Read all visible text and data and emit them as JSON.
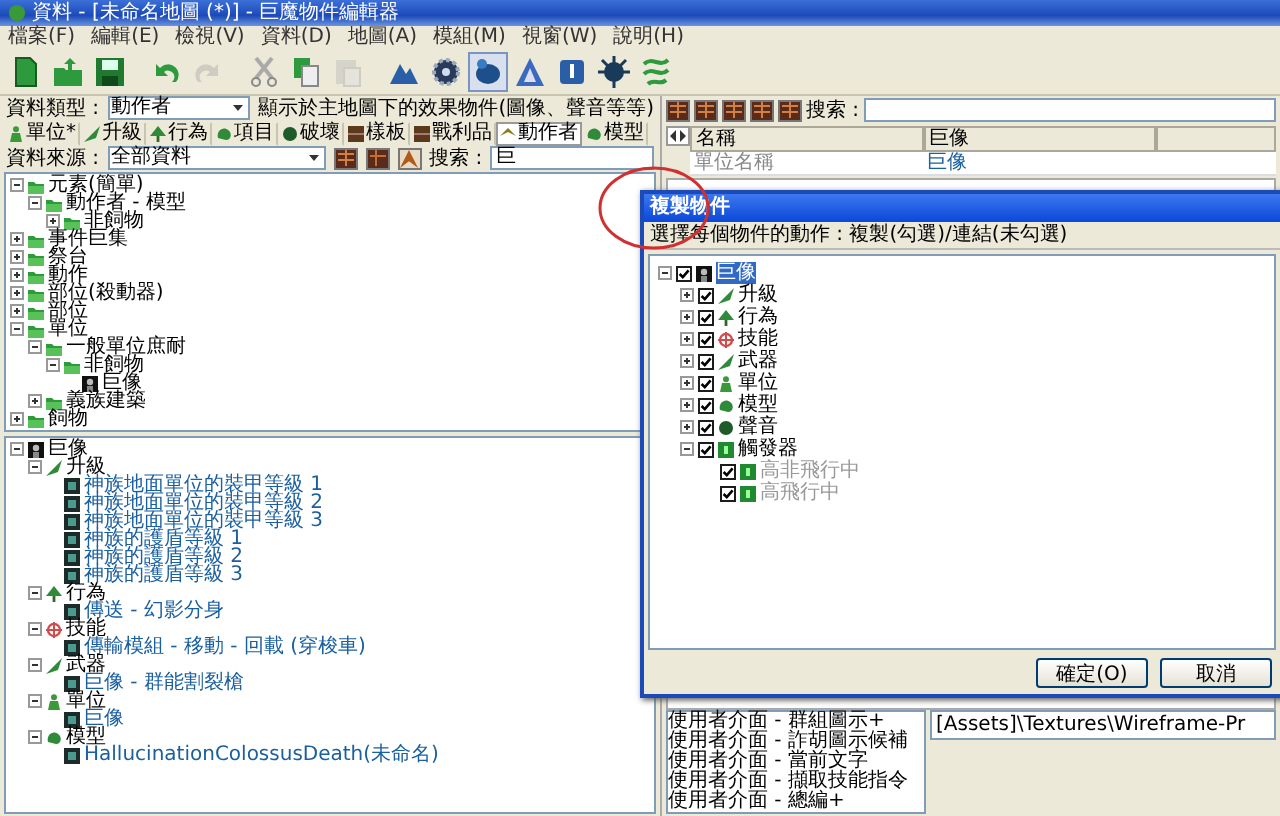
{
  "window": {
    "title": "資料 - [未命名地圖 (*)] - 巨魔物件編輯器"
  },
  "menu": [
    "檔案(F)",
    "編輯(E)",
    "檢視(V)",
    "資料(D)",
    "地圖(A)",
    "模組(M)",
    "視窗(W)",
    "說明(H)"
  ],
  "toolbar": [
    {
      "kind": "new",
      "disabled": false,
      "selected": false
    },
    {
      "kind": "open",
      "disabled": false,
      "selected": false
    },
    {
      "kind": "save",
      "disabled": false,
      "selected": false
    },
    {
      "kind": "undo",
      "disabled": false,
      "selected": false
    },
    {
      "kind": "redo",
      "disabled": true,
      "selected": false
    },
    {
      "kind": "cut",
      "disabled": false,
      "selected": false
    },
    {
      "kind": "copy",
      "disabled": false,
      "selected": false
    },
    {
      "kind": "paste",
      "disabled": true,
      "selected": false
    },
    {
      "kind": "terrain",
      "disabled": false,
      "selected": false
    },
    {
      "kind": "trigger",
      "disabled": false,
      "selected": false
    },
    {
      "kind": "object",
      "disabled": false,
      "selected": true
    },
    {
      "kind": "letter",
      "disabled": false,
      "selected": false
    },
    {
      "kind": "import",
      "disabled": false,
      "selected": false
    },
    {
      "kind": "creature",
      "disabled": false,
      "selected": false
    },
    {
      "kind": "dragon",
      "disabled": false,
      "selected": false
    }
  ],
  "data_type": {
    "label": "資料類型 :",
    "value": "動作者",
    "description": "顯示於主地圖下的效果物件(圖像、聲音等等)"
  },
  "tabs": [
    {
      "label": "單位*",
      "kind": "figure",
      "selected": false
    },
    {
      "label": "升級",
      "kind": "upgrade",
      "selected": false
    },
    {
      "label": "行為",
      "kind": "behavior",
      "selected": false
    },
    {
      "label": "項目",
      "kind": "model",
      "selected": false
    },
    {
      "label": "破壞",
      "kind": "sound",
      "selected": false
    },
    {
      "label": "樣板",
      "kind": "crate",
      "selected": false
    },
    {
      "label": "戰利品",
      "kind": "crate",
      "selected": false
    },
    {
      "label": "動作者",
      "kind": "actor",
      "selected": true
    },
    {
      "label": "模型",
      "kind": "model",
      "selected": false
    }
  ],
  "source": {
    "label": "資料來源 :",
    "value": "全部資料",
    "search_label": "搜索 :",
    "search_value": "巨"
  },
  "object_tree": [
    {
      "label": "元素(簡單)",
      "kind": "folder",
      "expanded": true,
      "children": [
        {
          "label": "動作者 - 模型",
          "kind": "folder",
          "expanded": true,
          "children": [
            {
              "label": "非飼物",
              "kind": "folder",
              "expanded": false
            }
          ]
        }
      ]
    },
    {
      "label": "事件巨集",
      "kind": "folder",
      "expanded": false
    },
    {
      "label": "祭台",
      "kind": "folder",
      "expanded": false
    },
    {
      "label": "動作",
      "kind": "folder",
      "expanded": false
    },
    {
      "label": "部位(殺動器)",
      "kind": "folder",
      "expanded": false
    },
    {
      "label": "部位",
      "kind": "folder",
      "expanded": false
    },
    {
      "label": "單位",
      "kind": "folder",
      "expanded": true,
      "children": [
        {
          "label": "一般單位庶耐",
          "kind": "folder",
          "expanded": true,
          "children": [
            {
              "label": "非飼物",
              "kind": "folder",
              "expanded": true,
              "children": [
                {
                  "label": "巨像",
                  "kind": "unit"
                }
              ]
            }
          ]
        },
        {
          "label": "義族建築",
          "kind": "folder",
          "expanded": false
        }
      ]
    },
    {
      "label": "飼物",
      "kind": "folder",
      "expanded": false
    }
  ],
  "detail_tree": [
    {
      "label": "巨像",
      "kind": "unit",
      "expanded": true,
      "children": [
        {
          "label": "升級",
          "kind": "upgrade",
          "expanded": true,
          "children": [
            {
              "label": "神族地面單位的裝甲等級 1",
              "kind": "entry"
            },
            {
              "label": "神族地面單位的裝甲等級 2",
              "kind": "entry"
            },
            {
              "label": "神族地面單位的裝甲等級 3",
              "kind": "entry"
            },
            {
              "label": "神族的護盾等級 1",
              "kind": "entry"
            },
            {
              "label": "神族的護盾等級 2",
              "kind": "entry"
            },
            {
              "label": "神族的護盾等級 3",
              "kind": "entry"
            }
          ]
        },
        {
          "label": "行為",
          "kind": "behavior",
          "expanded": true,
          "children": [
            {
              "label": "傳送 - 幻影分身",
              "kind": "entry"
            }
          ]
        },
        {
          "label": "技能",
          "kind": "skill",
          "expanded": true,
          "children": [
            {
              "label": "傳輸模組 - 移動 - 回載 (穿梭車)",
              "kind": "entry"
            }
          ]
        },
        {
          "label": "武器",
          "kind": "upgrade",
          "expanded": true,
          "children": [
            {
              "label": "巨像 - 群能割裂槍",
              "kind": "entry"
            }
          ]
        },
        {
          "label": "單位",
          "kind": "figure",
          "expanded": true,
          "children": [
            {
              "label": "巨像",
              "kind": "entry"
            }
          ]
        },
        {
          "label": "模型",
          "kind": "model",
          "expanded": true,
          "children": [
            {
              "label": "HallucinationColossusDeath(未命名)",
              "kind": "entry"
            }
          ]
        }
      ]
    }
  ],
  "right_panel": {
    "search_label": "搜索 :",
    "columns": [
      "名稱",
      "巨像"
    ],
    "rows": [
      {
        "field": "單位名稱",
        "value": "巨像"
      }
    ],
    "list": [
      "使用者介面 - 群組圖示+",
      "使用者介面 - 詐胡圖示候補",
      "使用者介面 - 當前文字",
      "使用者介面 - 擷取技能指令",
      "使用者介面 - 總編+"
    ],
    "path": "[Assets]\\Textures\\Wireframe-Pr"
  },
  "dialog": {
    "title": "複製物件",
    "prompt": "選擇每個物件的動作 : 複製(勾選)/連結(未勾選)",
    "tree": [
      {
        "label": "巨像",
        "kind": "unit",
        "checked": true,
        "selected": true,
        "disabled": false,
        "expanded": true,
        "children": [
          {
            "label": "升級",
            "kind": "upgrade",
            "checked": true,
            "selected": false,
            "disabled": false,
            "expanded": false
          },
          {
            "label": "行為",
            "kind": "behavior",
            "checked": true,
            "selected": false,
            "disabled": false,
            "expanded": false
          },
          {
            "label": "技能",
            "kind": "skill",
            "checked": true,
            "selected": false,
            "disabled": false,
            "expanded": false
          },
          {
            "label": "武器",
            "kind": "upgrade",
            "checked": true,
            "selected": false,
            "disabled": false,
            "expanded": false
          },
          {
            "label": "單位",
            "kind": "figure",
            "checked": true,
            "selected": false,
            "disabled": false,
            "expanded": false
          },
          {
            "label": "模型",
            "kind": "model",
            "checked": true,
            "selected": false,
            "disabled": false,
            "expanded": false
          },
          {
            "label": "聲音",
            "kind": "sound",
            "checked": true,
            "selected": false,
            "disabled": false,
            "expanded": false
          },
          {
            "label": "觸發器",
            "kind": "trigger",
            "checked": true,
            "selected": false,
            "disabled": false,
            "expanded": true,
            "children": [
              {
                "label": "高非飛行中",
                "kind": "trigger",
                "checked": true,
                "selected": false,
                "disabled": true
              },
              {
                "label": "高飛行中",
                "kind": "trigger",
                "checked": true,
                "selected": false,
                "disabled": true
              }
            ]
          }
        ]
      }
    ],
    "buttons": [
      "確定(O)",
      "取消"
    ]
  }
}
